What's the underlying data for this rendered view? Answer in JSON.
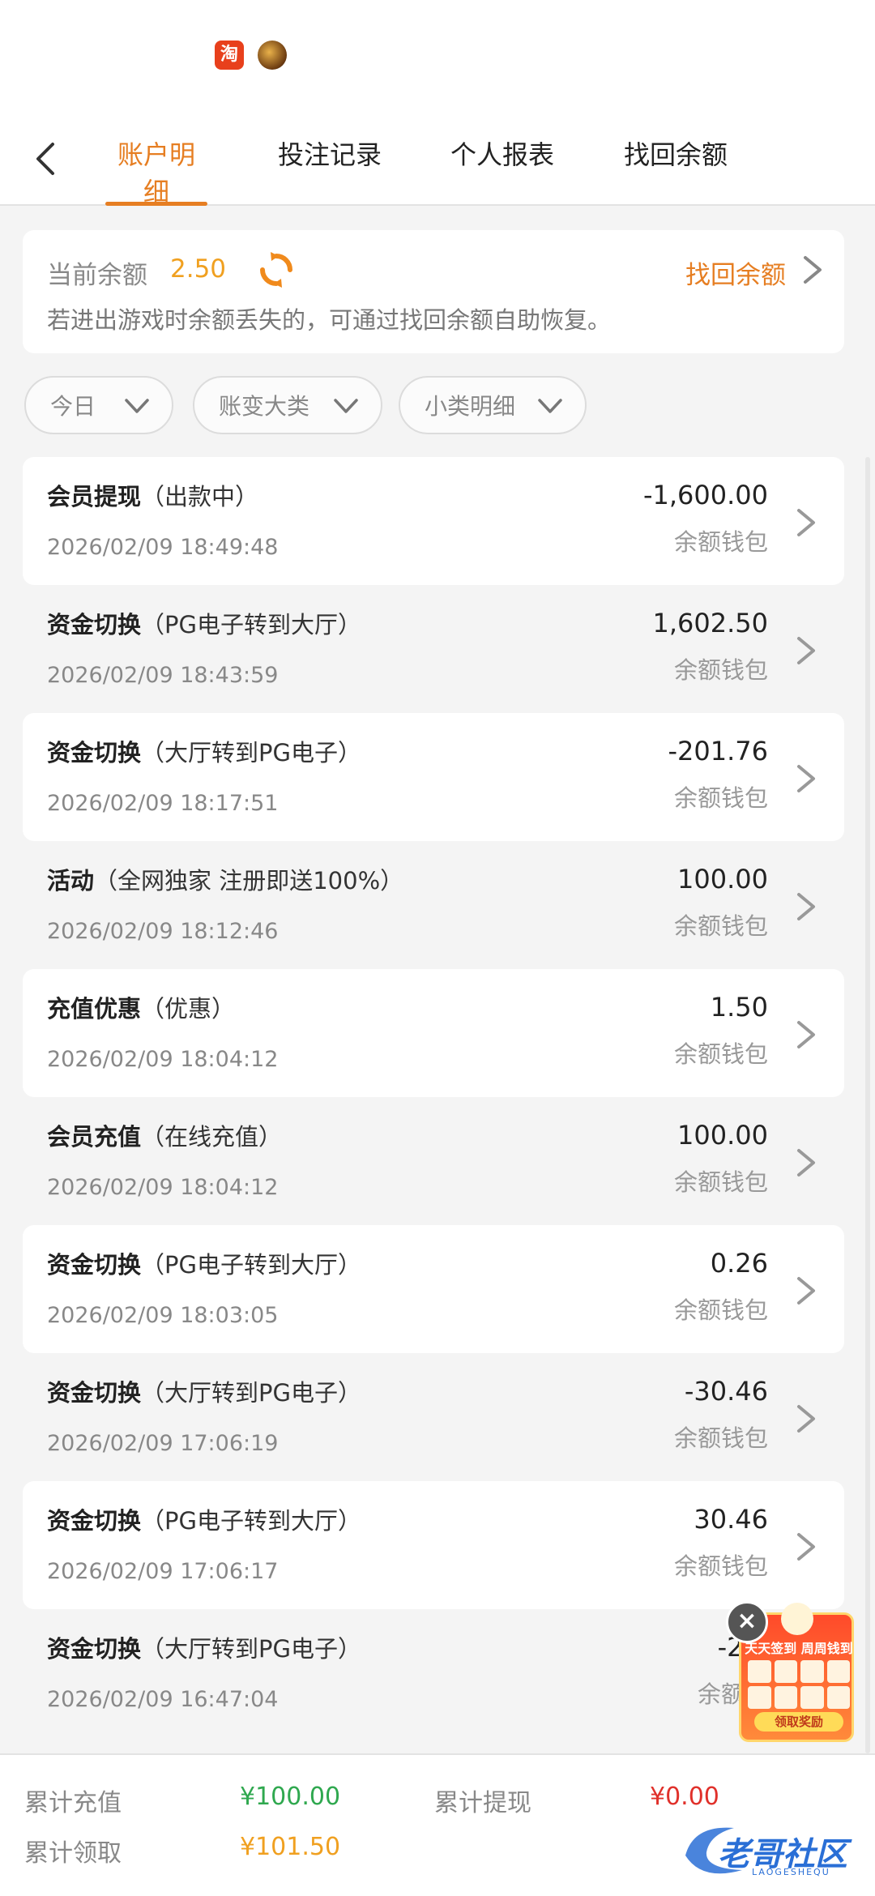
{
  "status_bar": {
    "app_icons": [
      "taobao-icon",
      "game-icon"
    ]
  },
  "nav": {
    "tabs": [
      {
        "label": "账户明细",
        "active": true
      },
      {
        "label": "投注记录",
        "active": false
      },
      {
        "label": "个人报表",
        "active": false
      },
      {
        "label": "找回余额",
        "active": false
      }
    ]
  },
  "balance": {
    "label": "当前余额",
    "value": "2.50",
    "recover_link": "找回余额",
    "hint": "若进出游戏时余额丢失的，可通过找回余额自助恢复。"
  },
  "filters": [
    {
      "label": "今日"
    },
    {
      "label": "账变大类"
    },
    {
      "label": "小类明细"
    }
  ],
  "records": [
    {
      "title": "会员提现",
      "sub": "（出款中）",
      "time": "2026/02/09 18:49:48",
      "amount": "-1,600.00",
      "wallet": "余额钱包"
    },
    {
      "title": "资金切换",
      "sub": "（PG电子转到大厅）",
      "time": "2026/02/09 18:43:59",
      "amount": "1,602.50",
      "wallet": "余额钱包"
    },
    {
      "title": "资金切换",
      "sub": "（大厅转到PG电子）",
      "time": "2026/02/09 18:17:51",
      "amount": "-201.76",
      "wallet": "余额钱包"
    },
    {
      "title": "活动",
      "sub": "（全网独家 注册即送100%）",
      "time": "2026/02/09 18:12:46",
      "amount": "100.00",
      "wallet": "余额钱包"
    },
    {
      "title": "充值优惠",
      "sub": "（优惠）",
      "time": "2026/02/09 18:04:12",
      "amount": "1.50",
      "wallet": "余额钱包"
    },
    {
      "title": "会员充值",
      "sub": "（在线充值）",
      "time": "2026/02/09 18:04:12",
      "amount": "100.00",
      "wallet": "余额钱包"
    },
    {
      "title": "资金切换",
      "sub": "（PG电子转到大厅）",
      "time": "2026/02/09 18:03:05",
      "amount": "0.26",
      "wallet": "余额钱包"
    },
    {
      "title": "资金切换",
      "sub": "（大厅转到PG电子）",
      "time": "2026/02/09 17:06:19",
      "amount": "-30.46",
      "wallet": "余额钱包"
    },
    {
      "title": "资金切换",
      "sub": "（PG电子转到大厅）",
      "time": "2026/02/09 17:06:17",
      "amount": "30.46",
      "wallet": "余额钱包"
    },
    {
      "title": "资金切换",
      "sub": "（大厅转到PG电子）",
      "time": "2026/02/09 16:47:04",
      "amount": "-25.",
      "wallet": "余额钱"
    }
  ],
  "footer": {
    "total_deposit_label": "累计充值",
    "total_deposit_value": "¥100.00",
    "total_withdraw_label": "累计提现",
    "total_withdraw_value": "¥0.00",
    "total_claim_label": "累计领取",
    "total_claim_value": "¥101.50"
  },
  "promo": {
    "title": "天天签到 周周钱到",
    "button": "领取奖励"
  },
  "watermark": {
    "text": "老哥社区",
    "sub": "LAOGESHEQU"
  },
  "colors": {
    "accent": "#e67e22",
    "balance": "#f0a020",
    "deposit": "#2fa84f",
    "withdraw": "#e0302a"
  }
}
